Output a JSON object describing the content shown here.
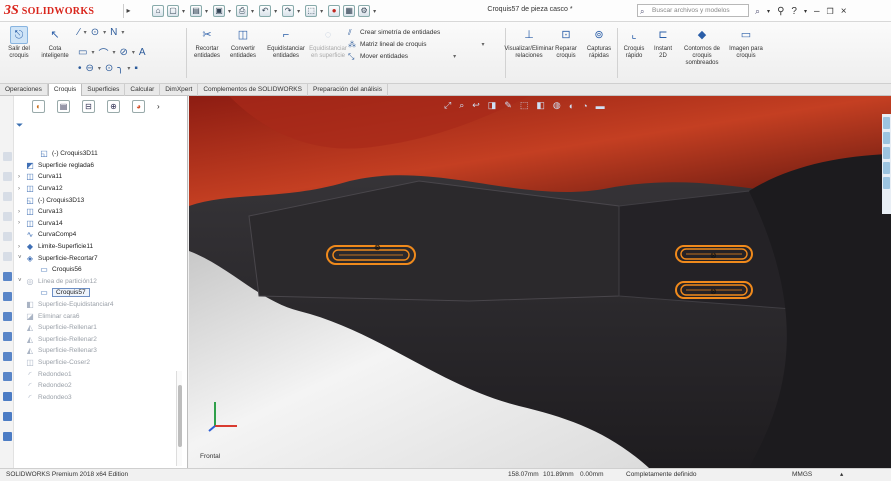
{
  "app": {
    "brand_ds": "3S",
    "brand_name": "SOLIDWORKS",
    "document_title": "Croquis57 de pieza casco *",
    "search_placeholder": "Buscar archivos y modelos",
    "help_label": "?"
  },
  "ribbon": {
    "buttons": [
      {
        "label": "Salir del croquis",
        "icon": "exit-sketch-icon"
      },
      {
        "label": "Cota inteligente",
        "icon": "smart-dimension-icon"
      },
      {
        "label": "Recortar entidades",
        "icon": "trim-icon"
      },
      {
        "label": "Convertir entidades",
        "icon": "convert-icon"
      },
      {
        "label": "Equidistanciar entidades",
        "icon": "offset-icon"
      },
      {
        "label": "Equidistanciar en superficie",
        "icon": "offset-surface-icon"
      }
    ],
    "mirror_list": [
      "Crear simetría de entidades",
      "Matriz lineal de croquis",
      "Mover entidades"
    ],
    "right_buttons": [
      {
        "label": "Visualizar/Eliminar relaciones",
        "icon": "relations-icon"
      },
      {
        "label": "Reparar croquis",
        "icon": "repair-icon"
      },
      {
        "label": "Capturas rápidas",
        "icon": "snaps-icon"
      },
      {
        "label": "Croquis rápido",
        "icon": "rapid-sketch-icon"
      },
      {
        "label": "Instant 2D",
        "icon": "instant2d-icon"
      },
      {
        "label": "Contornos de croquis sombreados",
        "icon": "shaded-contours-icon"
      },
      {
        "label": "Imagen para croquis",
        "icon": "sketch-picture-icon"
      }
    ]
  },
  "tabs": [
    {
      "label": "Operaciones",
      "active": false
    },
    {
      "label": "Croquis",
      "active": true
    },
    {
      "label": "Superficies",
      "active": false
    },
    {
      "label": "Calcular",
      "active": false
    },
    {
      "label": "DimXpert",
      "active": false
    },
    {
      "label": "Complementos de SOLIDWORKS",
      "active": false
    },
    {
      "label": "Preparación del análisis",
      "active": false
    }
  ],
  "tree": [
    {
      "label": "(-) Croquis3D11",
      "icon": "sketch3d-icon",
      "exp": "",
      "dim": false,
      "indent": 3
    },
    {
      "label": "Superficie reglada6",
      "icon": "ruled-surface-icon",
      "exp": "",
      "dim": false,
      "indent": 1
    },
    {
      "label": "Curva11",
      "icon": "curve-icon",
      "exp": "›",
      "dim": false,
      "indent": 1
    },
    {
      "label": "Curva12",
      "icon": "curve-icon",
      "exp": "›",
      "dim": false,
      "indent": 1
    },
    {
      "label": "(-) Croquis3D13",
      "icon": "sketch3d-icon",
      "exp": "",
      "dim": false,
      "indent": 1
    },
    {
      "label": "Curva13",
      "icon": "curve-icon",
      "exp": "›",
      "dim": false,
      "indent": 1
    },
    {
      "label": "Curva14",
      "icon": "curve-icon",
      "exp": "›",
      "dim": false,
      "indent": 1
    },
    {
      "label": "CurvaComp4",
      "icon": "composite-curve-icon",
      "exp": "",
      "dim": false,
      "indent": 1
    },
    {
      "label": "Limite-Superficie11",
      "icon": "boundary-surface-icon",
      "exp": "›",
      "dim": false,
      "indent": 1
    },
    {
      "label": "Superficie-Recortar7",
      "icon": "trim-surface-icon",
      "exp": "˅",
      "dim": false,
      "indent": 1
    },
    {
      "label": "Croquis56",
      "icon": "sketch-icon",
      "exp": "",
      "dim": false,
      "indent": 3
    },
    {
      "label": "Línea de partición12",
      "icon": "split-line-icon",
      "exp": "˅",
      "dim": true,
      "indent": 1
    },
    {
      "label": "Croquis57",
      "icon": "sketch-icon",
      "exp": "",
      "dim": false,
      "indent": 3,
      "selected": true
    },
    {
      "label": "Superficie-Equidistanciar4",
      "icon": "offset-surface-icon",
      "exp": "",
      "dim": true,
      "indent": 1
    },
    {
      "label": "Eliminar cara6",
      "icon": "delete-face-icon",
      "exp": "",
      "dim": true,
      "indent": 1
    },
    {
      "label": "Superficie-Rellenar1",
      "icon": "fill-surface-icon",
      "exp": "",
      "dim": true,
      "indent": 1
    },
    {
      "label": "Superficie-Rellenar2",
      "icon": "fill-surface-icon",
      "exp": "",
      "dim": true,
      "indent": 1
    },
    {
      "label": "Superficie-Rellenar3",
      "icon": "fill-surface-icon",
      "exp": "",
      "dim": true,
      "indent": 1
    },
    {
      "label": "Superficie-Coser2",
      "icon": "knit-surface-icon",
      "exp": "",
      "dim": true,
      "indent": 1
    },
    {
      "label": "Redondeo1",
      "icon": "fillet-icon",
      "exp": "",
      "dim": true,
      "indent": 1
    },
    {
      "label": "Redondeo2",
      "icon": "fillet-icon",
      "exp": "",
      "dim": true,
      "indent": 1
    },
    {
      "label": "Redondeo3",
      "icon": "fillet-icon",
      "exp": "",
      "dim": true,
      "indent": 1
    }
  ],
  "viewport": {
    "orientation_label": "Frontal",
    "triad_colors": {
      "x": "#d93b30",
      "y": "#2fa04a",
      "z": "#2d5fd6"
    }
  },
  "status": {
    "edition": "SOLIDWORKS Premium 2018 x64 Edition",
    "coord1": "158.07mm",
    "coord2": "101.89mm",
    "coord3": "0.00mm",
    "state": "Completamente definido",
    "units": "MMGS"
  },
  "colors": {
    "accent": "#d9251c",
    "slot_orange": "#f08a1c",
    "selection_blue": "#6d8fc4"
  }
}
